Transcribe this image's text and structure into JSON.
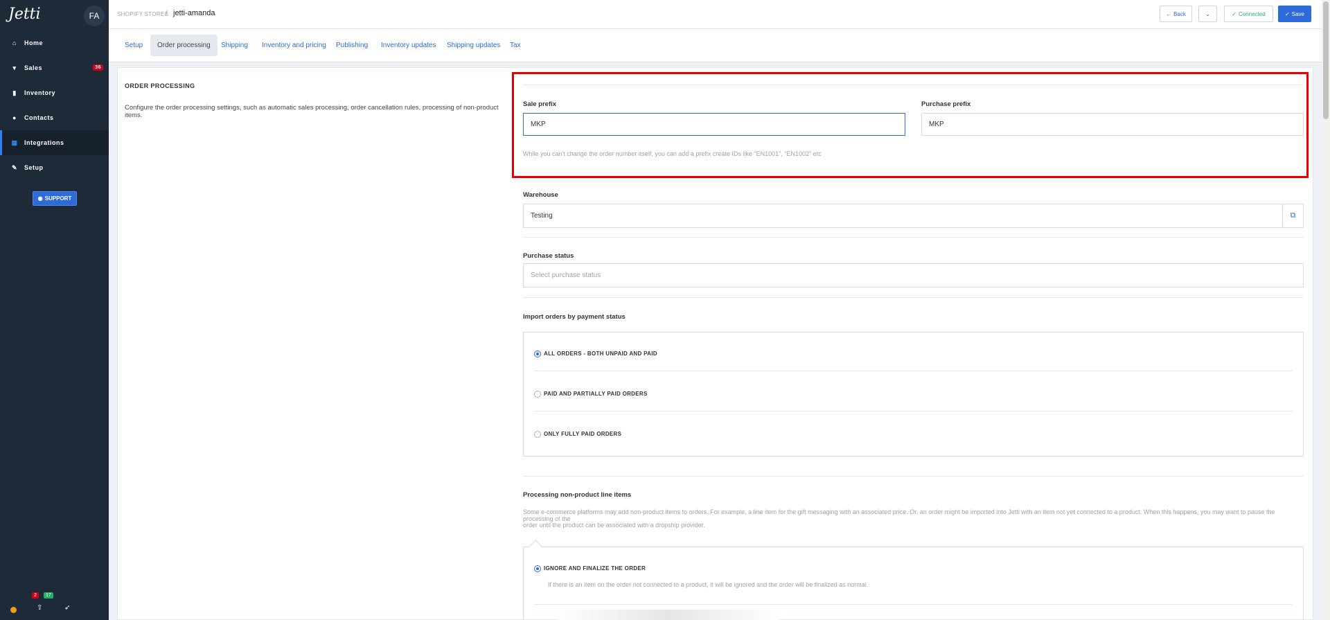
{
  "sidebar": {
    "logo": "Jetti",
    "avatar": "FA",
    "items": [
      {
        "label": "Home",
        "icon": "home-icon"
      },
      {
        "label": "Sales",
        "icon": "cart-icon",
        "badge": "36"
      },
      {
        "label": "Inventory",
        "icon": "bookmark-icon"
      },
      {
        "label": "Contacts",
        "icon": "person-icon"
      },
      {
        "label": "Integrations",
        "icon": "grid-icon"
      },
      {
        "label": "Setup",
        "icon": "wrench-icon"
      }
    ],
    "support_label": "SUPPORT",
    "bottom": {
      "badge_red": "2",
      "badge_green": "17"
    }
  },
  "header": {
    "breadcrumb": "SHOPIFY STORES",
    "separator": "/",
    "store_name": "jetti-amanda",
    "back_label": "Back",
    "connected_label": "Connected",
    "save_label": "Save"
  },
  "tabs": [
    "Setup",
    "Order processing",
    "Shipping",
    "Inventory and pricing",
    "Publishing",
    "Inventory updates",
    "Shipping updates",
    "Tax"
  ],
  "section": {
    "title": "ORDER PROCESSING",
    "description": "Configure the order processing settings, such as automatic sales processing, order cancellation rules, processing of non-product items."
  },
  "form": {
    "sale_prefix_label": "Sale prefix",
    "sale_prefix_value": "MKP",
    "purchase_prefix_label": "Purchase prefix",
    "purchase_prefix_value": "MKP",
    "prefix_hint": "While you can't change the order number itself, you can add a prefix create IDs like \"EN1001\", \"EN1002\" etc",
    "warehouse_label": "Warehouse",
    "warehouse_value": "Testing",
    "purchase_status_label": "Purchase status",
    "purchase_status_placeholder": "Select purchase status",
    "payment_status_label": "Import orders by payment status",
    "payment_options": [
      "ALL ORDERS - BOTH UNPAID AND PAID",
      "PAID AND PARTIALLY PAID ORDERS",
      "ONLY FULLY PAID ORDERS"
    ],
    "non_product_label": "Processing non-product line items",
    "non_product_desc_1": "Some e-commerce platforms may add non-product items to orders. For example, a line item for the gift messaging with an associated price. Or, an order might be imported into Jetti with an item not yet connected to a product. When this happens, you may want to pause the processing of the",
    "non_product_desc_2": "order until the product can be associated with a dropship provider.",
    "non_product_option": "IGNORE AND FINALIZE THE ORDER",
    "non_product_option_desc": "If there is an item on the order not connected to a product, it will be ignored and the order will be finalized as normal."
  },
  "colors": {
    "accent": "#2d6bd8",
    "sidebar": "#1e2a38",
    "highlight": "#e60000",
    "success": "#27ae60"
  }
}
